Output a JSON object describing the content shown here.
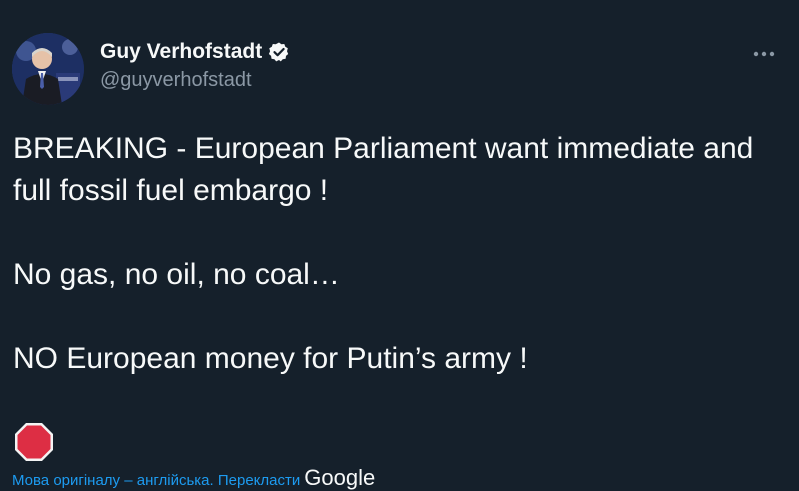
{
  "author": {
    "display_name": "Guy Verhofstadt",
    "handle": "@guyverhofstadt",
    "verified": true
  },
  "menu": {
    "more_icon": "more-horizontal-icon"
  },
  "tweet": {
    "lines": [
      "BREAKING - European Parliament want immediate and full fossil fuel embargo !",
      "No gas, no oil, no coal…",
      "NO European money for Putin’s army !"
    ],
    "emoji": "stop-sign-icon"
  },
  "translation": {
    "link_text": "Мова оригіналу – англійська. Перекласти",
    "provider": "Google"
  },
  "colors": {
    "background": "#15202b",
    "text": "#f7f9f9",
    "muted": "#8b98a5",
    "accent": "#1d9bf0"
  }
}
